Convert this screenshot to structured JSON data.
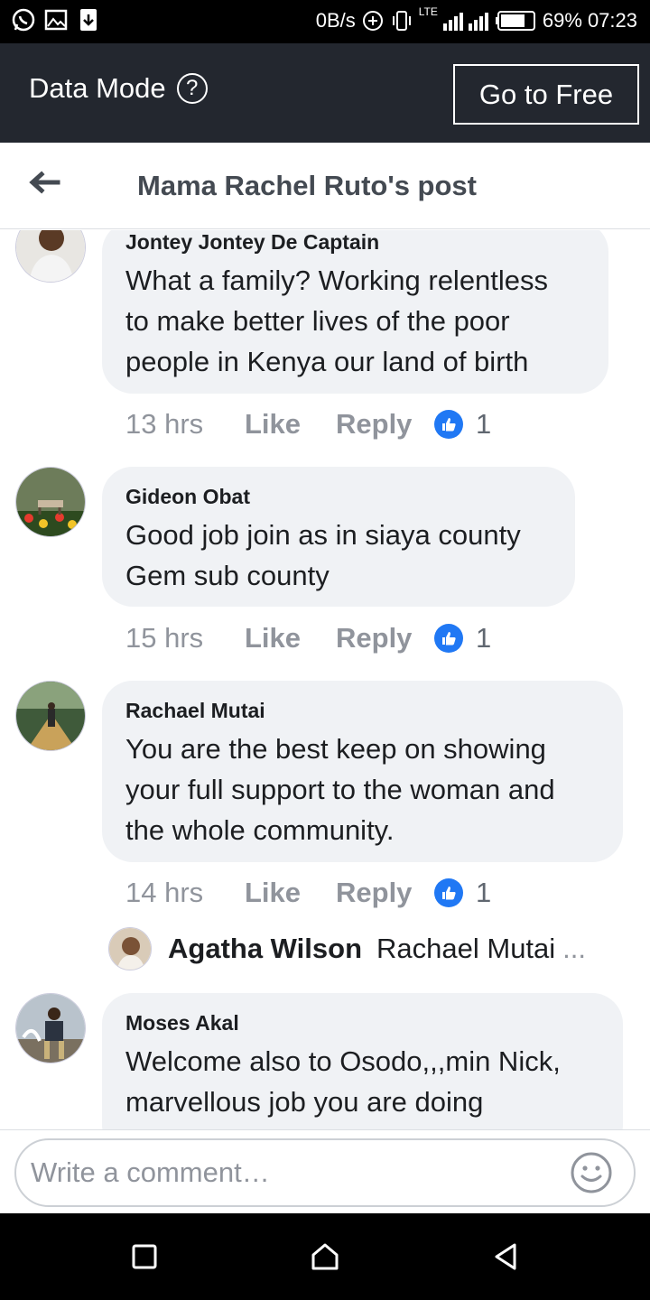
{
  "status_bar": {
    "speed": "0B/s",
    "network": "LTE",
    "battery": "69%",
    "time": "07:23",
    "icons": [
      "whatsapp-icon",
      "gallery-icon",
      "download-icon",
      "data-saver-icon",
      "vibrate-icon",
      "signal-icon",
      "battery-icon"
    ]
  },
  "data_mode": {
    "label": "Data Mode",
    "help_glyph": "?",
    "button": "Go to Free",
    "colors": {
      "background": "#23272f",
      "text": "#ffffff"
    }
  },
  "header": {
    "title": "Mama Rachel Ruto's post"
  },
  "comments": [
    {
      "name": "Jontey Jontey De Captain",
      "lines": [
        "What a family? Working relentless",
        "to make better lives of the poor",
        "people in Kenya our land of birth"
      ],
      "time": "13 hrs",
      "like": "Like",
      "reply": "Reply",
      "reactions": "1"
    },
    {
      "name": "Gideon Obat",
      "lines": [
        "Good job join as in siaya county",
        "Gem sub county"
      ],
      "time": "15 hrs",
      "like": "Like",
      "reply": "Reply",
      "reactions": "1"
    },
    {
      "name": "Rachael Mutai",
      "lines": [
        "You are the best keep on showing",
        "your full support to the woman and",
        "the whole community."
      ],
      "time": "14 hrs",
      "like": "Like",
      "reply": "Reply",
      "reactions": "1"
    },
    {
      "name": "Moses Akal",
      "lines": [
        "Welcome also to Osodo,,,min  Nick,",
        "marvellous job you are doing"
      ]
    }
  ],
  "reply_preview": {
    "name": "Agatha Wilson",
    "text": "Rachael Mutai",
    "ellipsis": "..."
  },
  "composer": {
    "placeholder": "Write a comment…"
  },
  "colors": {
    "bubble": "#f0f2f5",
    "like_blue": "#2078f4",
    "meta_gray": "#90949c"
  }
}
